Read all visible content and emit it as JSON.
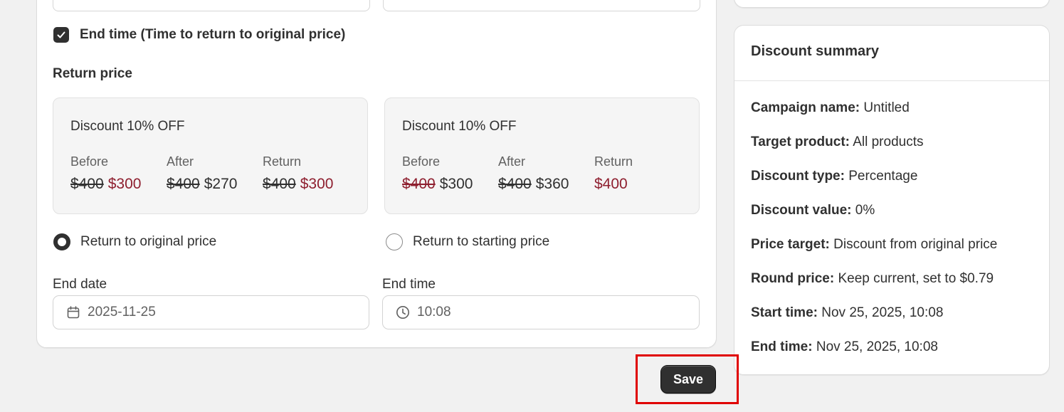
{
  "end_time_section": {
    "checkbox_label": "End time (Time to return to original price)",
    "checkbox_checked": true
  },
  "return_price": {
    "title": "Return price",
    "boxes": [
      {
        "title": "Discount 10% OFF",
        "before_label": "Before",
        "after_label": "After",
        "return_label": "Return",
        "before_old": "$400",
        "before_new": "$300",
        "after_old": "$400",
        "after_new": "$270",
        "return_old": "$400",
        "return_new": "$300"
      },
      {
        "title": "Discount 10% OFF",
        "before_label": "Before",
        "after_label": "After",
        "return_label": "Return",
        "before_old": "$400",
        "before_new": "$300",
        "after_old": "$400",
        "after_new": "$360",
        "return_new": "$400"
      }
    ],
    "options": [
      {
        "label": "Return to original price",
        "selected": true
      },
      {
        "label": "Return to starting price",
        "selected": false
      }
    ]
  },
  "end_date": {
    "label": "End date",
    "value": "2025-11-25"
  },
  "end_time": {
    "label": "End time",
    "value": "10:08"
  },
  "summary": {
    "title": "Discount summary",
    "items": [
      {
        "key": "Campaign name:",
        "value": "Untitled"
      },
      {
        "key": "Target product:",
        "value": "All products"
      },
      {
        "key": "Discount type:",
        "value": "Percentage"
      },
      {
        "key": "Discount value:",
        "value": "0%"
      },
      {
        "key": "Price target:",
        "value": "Discount from original price"
      },
      {
        "key": "Round price:",
        "value": "Keep current, set to $0.79"
      },
      {
        "key": "Start time:",
        "value": "Nov 25, 2025, 10:08"
      },
      {
        "key": "End time:",
        "value": "Nov 25, 2025, 10:08"
      }
    ]
  },
  "save_label": "Save",
  "colors": {
    "accent_red": "#8e1f2f",
    "dark": "#303030",
    "highlight": "#e00000"
  }
}
